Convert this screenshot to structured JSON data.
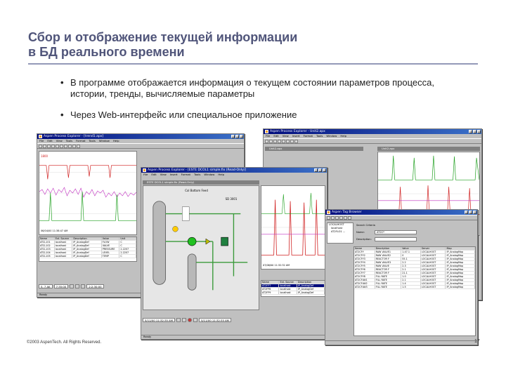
{
  "slide": {
    "title_line1": "Сбор и отображение текущей информации",
    "title_line2": "в БД реального времени",
    "bullets": [
      "В программе отображается информация о текущем состоянии параметров процесса, истории, тренды, вычисляемые параметры",
      "Через Web-интерфейс или специальное приложение"
    ],
    "footer": "©2003 AspenTech. All Rights Reserved.",
    "page_number": "17"
  },
  "colors": {
    "title": "#50557a",
    "titlebar_start": "#000a7b",
    "titlebar_end": "#3c72c9",
    "trend_red": "#d02020",
    "trend_magenta": "#c030c0",
    "trend_green": "#20a020",
    "window_gray": "#c0c0c0"
  },
  "icons": [
    "app-icon",
    "minimize-icon",
    "maximize-icon",
    "close-icon",
    "toolbar-icon",
    "play-icon",
    "record-icon",
    "folder-icon"
  ],
  "windows": {
    "w1": {
      "title": "Aspen Process Explorer - [trend1.apx]",
      "menus": [
        "File",
        "Edit",
        "View",
        "Tools",
        "Format",
        "Tools",
        "Window",
        "Help"
      ],
      "status": "Ready",
      "axis_left": "1800",
      "axis_time": "06/04/00 11:38:47 AM",
      "time_range": "5, 7 AK",
      "time_span": "7:35:00",
      "time_end": "2:2:30:00",
      "table_head": [
        "Name",
        "Ext. Source",
        "Description",
        "Value",
        "Unit"
      ],
      "table_rows": [
        [
          "ATCL101",
          "localhost",
          "IP_AnalogDef",
          "FLOW",
          "C"
        ],
        [
          "ATCL102",
          "localhost",
          "IP_AnalogDef",
          "VALVE",
          "C"
        ],
        [
          "ATCL103",
          "localhost",
          "IP_AnalogDef",
          "PRESSURE",
          "2.2207"
        ],
        [
          "ATCL104",
          "localhost",
          "IP_AnalogDef",
          "LEVEL",
          "2.2207"
        ],
        [
          "ATCL105",
          "localhost",
          "IP_AnalogDef",
          "TEMP",
          "C"
        ]
      ]
    },
    "w2": {
      "title": "Aspen Process Explorer - Unit2.apx",
      "inner_title": "Unit2.apx",
      "inner_title2": "Unit2.apx",
      "menus": [
        "File",
        "Edit",
        "View",
        "Insert",
        "Format",
        "Tools",
        "Window",
        "Help"
      ]
    },
    "w3": {
      "title": "Aspen Process Explorer - [ESTE DCOL1 simple.fix (Read-Only)]",
      "inner_title": "ESTE DCOL1 simple.fix (Read-Only)",
      "menus": [
        "File",
        "Edit",
        "View",
        "Insert",
        "Format",
        "Tools",
        "Window",
        "Help"
      ],
      "graphic_label1": "Col Bottom Feed",
      "graphic_label2": "SD 3001",
      "axis_time": "07/06/00 11:32:32 AM",
      "time_range": "5/11/00 11:32:35 AM",
      "time_end": "5/11/00 11:32:35 AM",
      "status": "Ready",
      "table_head": [
        "Name",
        "Ext. Source",
        "Description"
      ],
      "table_rows": [
        [
          "AT2FP7",
          "localhost",
          "IP_AnalogDef"
        ],
        [
          "AT2FP8",
          "localhost",
          "IP_AnalogDef"
        ],
        [
          "AT2FP9",
          "localhost",
          "IP_AnalogDef"
        ]
      ]
    },
    "w4": {
      "title": "Aspen Tag Browser",
      "search_label": "Search Criteria",
      "field1_label": "Name:",
      "field1_value": "AT2C*",
      "field2_label": "Description:",
      "tree_root": "LOCALHOST",
      "tree_items": [
        "localhost",
        "AT2FLO1 ..."
      ],
      "table_head": [
        "Name",
        "Description",
        "Value",
        "Server",
        "Map"
      ],
      "table_rows": [
        [
          "AT2CFY",
          "RAW VALVE1",
          "1.47.1",
          "LOCALHOST",
          "IP_AnalogMap"
        ],
        [
          "AT2CFY2",
          "RAW VALVE2",
          "0",
          "LOCALHOST",
          "IP_AnalogMap"
        ],
        [
          "AT2CFY3",
          "REACTOR F",
          "55.1",
          "LOCALHOST",
          "IP_AnalogMap"
        ],
        [
          "AT2CFY4",
          "RAW VALVE3",
          "2.2",
          "LOCALHOST",
          "IP_AnalogMap"
        ],
        [
          "AT2CFY5",
          "RAW VALVE",
          "2.3",
          "LOCALHOST",
          "IP_AnalogMap"
        ],
        [
          "AT2CFY6",
          "REACTOR F",
          "2.1",
          "LOCALHOST",
          "IP_AnalogMap"
        ],
        [
          "AT2CFY7",
          "REACTOR F",
          "21.1",
          "LOCALHOST",
          "IP_AnalogMap"
        ],
        [
          "AT2CFY8",
          "FILL RATE",
          "1.0",
          "LOCALHOST",
          "IP_AnalogMap"
        ],
        [
          "AT2CFLW1",
          "FILL RATE",
          "2.1",
          "LOCALHOST",
          "IP_AnalogMap"
        ],
        [
          "AT2CFLW2",
          "FILL RATE",
          "1.4",
          "LOCALHOST",
          "IP_AnalogMap"
        ],
        [
          "AT2CFLW3",
          "FILL RATE",
          "1.5",
          "LOCALHOST",
          "IP_AnalogMap"
        ]
      ]
    }
  }
}
